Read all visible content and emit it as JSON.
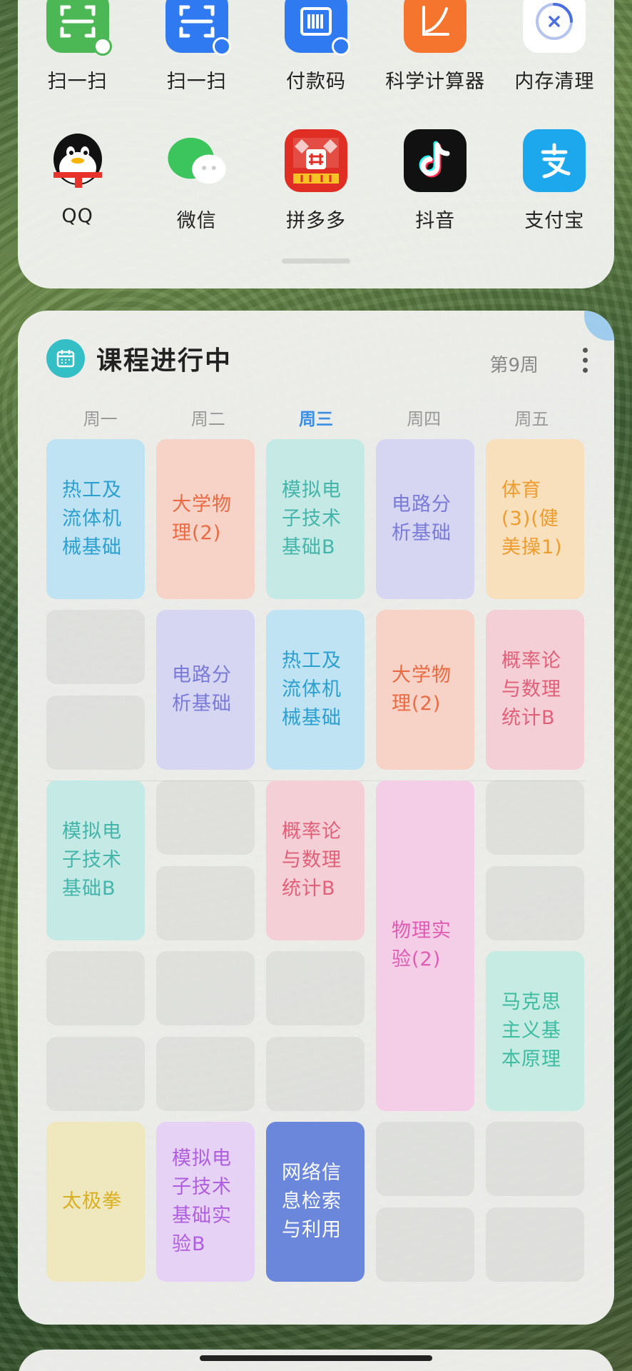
{
  "apps": [
    {
      "name": "扫一扫",
      "icon": "wechat-scan-icon",
      "color": "#4bb855"
    },
    {
      "name": "扫一扫",
      "icon": "alipay-scan-icon",
      "color": "#2f7af0"
    },
    {
      "name": "付款码",
      "icon": "payment-code-icon",
      "color": "#2f7af0"
    },
    {
      "name": "科学计算器",
      "icon": "calculator-icon",
      "color": "#f5742e"
    },
    {
      "name": "内存清理",
      "icon": "memory-clean-icon",
      "color": "#ffffff"
    },
    {
      "name": "QQ",
      "icon": "qq-icon",
      "color": "#f2f2f2"
    },
    {
      "name": "微信",
      "icon": "wechat-icon",
      "color": "#3cc55c"
    },
    {
      "name": "拼多多",
      "icon": "pinduoduo-icon",
      "color": "#e02e24"
    },
    {
      "name": "抖音",
      "icon": "douyin-icon",
      "color": "#111111"
    },
    {
      "name": "支付宝",
      "icon": "alipay-icon",
      "color": "#1da8ee"
    }
  ],
  "widget": {
    "title": "课程进行中",
    "week": "第9周",
    "days": [
      "周一",
      "周二",
      "周三",
      "周四",
      "周五"
    ],
    "today_index": 2
  },
  "courses": [
    {
      "day": 0,
      "start": 0,
      "span": 2,
      "name": "热工及流体机械基础",
      "color": "#2a9fd0",
      "bg": "#bfe3f2"
    },
    {
      "day": 1,
      "start": 0,
      "span": 2,
      "name": "大学物理(2)",
      "color": "#ea6a44",
      "bg": "#f6d3c6"
    },
    {
      "day": 2,
      "start": 0,
      "span": 2,
      "name": "模拟电子技术基础B",
      "color": "#43b5aa",
      "bg": "#c5e9e4"
    },
    {
      "day": 3,
      "start": 0,
      "span": 2,
      "name": "电路分析基础",
      "color": "#7a7ad8",
      "bg": "#d6d6f2"
    },
    {
      "day": 4,
      "start": 0,
      "span": 2,
      "name": "体育(3)(健美操1)",
      "color": "#ee9c2e",
      "bg": "#f8e0bc"
    },
    {
      "day": 1,
      "start": 2,
      "span": 2,
      "name": "电路分析基础",
      "color": "#7a7ad8",
      "bg": "#d6d6f2"
    },
    {
      "day": 2,
      "start": 2,
      "span": 2,
      "name": "热工及流体机械基础",
      "color": "#2a9fd0",
      "bg": "#bfe3f2"
    },
    {
      "day": 3,
      "start": 2,
      "span": 2,
      "name": "大学物理(2)",
      "color": "#ea6a44",
      "bg": "#f6d3c6"
    },
    {
      "day": 4,
      "start": 2,
      "span": 2,
      "name": "概率论与数理统计B",
      "color": "#e0607a",
      "bg": "#f4cfd5"
    },
    {
      "day": 0,
      "start": 4,
      "span": 2,
      "name": "模拟电子技术基础B",
      "color": "#43b5aa",
      "bg": "#c5e9e4"
    },
    {
      "day": 2,
      "start": 4,
      "span": 2,
      "name": "概率论与数理统计B",
      "color": "#e0607a",
      "bg": "#f4cfd5"
    },
    {
      "day": 3,
      "start": 4,
      "span": 4,
      "name": "物理实验(2)",
      "color": "#e05cb2",
      "bg": "#f4cde6"
    },
    {
      "day": 4,
      "start": 6,
      "span": 2,
      "name": "马克思主义基本原理",
      "color": "#3cbca0",
      "bg": "#c6ebe2"
    },
    {
      "day": 0,
      "start": 8,
      "span": 2,
      "name": "太极拳",
      "color": "#d9b020",
      "bg": "#efe7bd"
    },
    {
      "day": 1,
      "start": 8,
      "span": 2,
      "name": "模拟电子技术基础实验B",
      "color": "#b05ee0",
      "bg": "#e6d2f4"
    },
    {
      "day": 2,
      "start": 8,
      "span": 2,
      "name": "网络信息检索与利用",
      "color": "#ffffff",
      "bg": "#6b87dc"
    }
  ],
  "empty_slots": [
    {
      "day": 0,
      "slot": 2
    },
    {
      "day": 0,
      "slot": 3
    },
    {
      "day": 1,
      "slot": 4
    },
    {
      "day": 1,
      "slot": 5
    },
    {
      "day": 4,
      "slot": 4
    },
    {
      "day": 4,
      "slot": 5
    },
    {
      "day": 0,
      "slot": 6
    },
    {
      "day": 1,
      "slot": 6
    },
    {
      "day": 2,
      "slot": 6
    },
    {
      "day": 0,
      "slot": 7
    },
    {
      "day": 1,
      "slot": 7
    },
    {
      "day": 2,
      "slot": 7
    },
    {
      "day": 3,
      "slot": 8
    },
    {
      "day": 4,
      "slot": 8
    },
    {
      "day": 3,
      "slot": 9
    },
    {
      "day": 4,
      "slot": 9
    }
  ]
}
